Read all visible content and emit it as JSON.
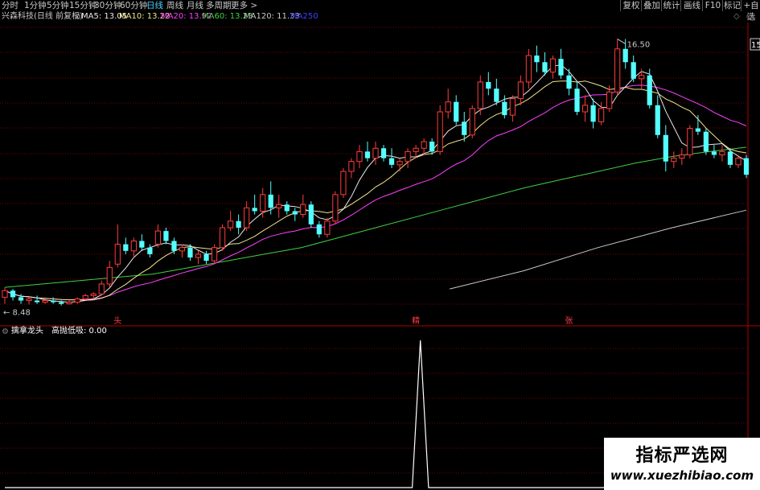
{
  "periods": [
    "分时",
    "1分钟",
    "5分钟",
    "15分钟",
    "30分钟",
    "60分钟",
    "日线",
    "周线",
    "月线",
    "多周期",
    "更多 >"
  ],
  "active_period": "日线",
  "toolbar": [
    "复权",
    "叠加",
    "统计",
    "画线",
    "F10",
    "标记",
    "+自选"
  ],
  "main": {
    "title": "兴森科技(日线 前复权)",
    "ma": [
      {
        "label": "MA5: 13.05",
        "color": "#e8e8e8"
      },
      {
        "label": "MA10: 13.22",
        "color": "#f0e68c"
      },
      {
        "label": "MA20: 13.92",
        "color": "#ff40ff"
      },
      {
        "label": "MA60: 13.23",
        "color": "#40d040"
      },
      {
        "label": "MA120: 11.33",
        "color": "#c8c8c8"
      },
      {
        "label": "MA250",
        "color": "#4040ff"
      }
    ],
    "high_label": "16.50",
    "low_label": "8.48",
    "right_label": "15",
    "signals": [
      {
        "text": "头",
        "idx": 14
      },
      {
        "text": "精",
        "idx": 51
      },
      {
        "text": "张",
        "idx": 70
      }
    ]
  },
  "sub": {
    "title": "擒拿龙头",
    "value_label": "高抛低吸: 0.00"
  },
  "watermark": {
    "cn": "指标严选网",
    "url": "www.xuezhibiao.com"
  },
  "colors": {
    "up": "#ff3c3c",
    "down": "#54ffff",
    "ma5": "#e8e8e8",
    "ma10": "#f0e68c",
    "ma20": "#ff40ff",
    "ma60": "#40d040",
    "ma120": "#c8c8c8",
    "grid": "#7a0000"
  },
  "chart_data": {
    "type": "candlestick",
    "candles": [
      [
        8.7,
        9.0,
        8.5,
        8.9
      ],
      [
        8.9,
        8.95,
        8.6,
        8.7
      ],
      [
        8.7,
        8.8,
        8.5,
        8.6
      ],
      [
        8.6,
        8.7,
        8.48,
        8.65
      ],
      [
        8.6,
        8.75,
        8.5,
        8.55
      ],
      [
        8.55,
        8.65,
        8.5,
        8.6
      ],
      [
        8.6,
        8.7,
        8.5,
        8.55
      ],
      [
        8.55,
        8.6,
        8.45,
        8.5
      ],
      [
        8.5,
        8.6,
        8.48,
        8.55
      ],
      [
        8.55,
        8.7,
        8.5,
        8.65
      ],
      [
        8.65,
        8.8,
        8.6,
        8.75
      ],
      [
        8.75,
        8.85,
        8.65,
        8.8
      ],
      [
        8.8,
        9.2,
        8.75,
        9.1
      ],
      [
        9.1,
        9.8,
        9.0,
        9.6
      ],
      [
        9.7,
        10.9,
        9.6,
        10.3
      ],
      [
        10.3,
        10.5,
        10.0,
        10.1
      ],
      [
        10.1,
        10.5,
        9.9,
        10.4
      ],
      [
        10.4,
        10.6,
        10.1,
        10.2
      ],
      [
        10.2,
        10.3,
        9.9,
        10.0
      ],
      [
        10.3,
        10.9,
        10.2,
        10.7
      ],
      [
        10.7,
        10.8,
        10.3,
        10.4
      ],
      [
        10.4,
        10.5,
        10.0,
        10.1
      ],
      [
        10.1,
        10.3,
        9.9,
        10.2
      ],
      [
        10.2,
        10.3,
        9.8,
        9.9
      ],
      [
        9.9,
        10.1,
        9.7,
        10.0
      ],
      [
        10.0,
        10.1,
        9.7,
        9.8
      ],
      [
        9.8,
        10.3,
        9.7,
        10.2
      ],
      [
        10.2,
        10.9,
        10.1,
        10.8
      ],
      [
        10.8,
        11.3,
        10.7,
        11.0
      ],
      [
        11.0,
        11.2,
        10.6,
        10.8
      ],
      [
        10.8,
        11.6,
        10.7,
        11.4
      ],
      [
        11.4,
        11.8,
        11.2,
        11.3
      ],
      [
        11.3,
        12.0,
        11.1,
        11.8
      ],
      [
        11.8,
        12.2,
        11.2,
        11.4
      ],
      [
        11.4,
        11.8,
        11.1,
        11.5
      ],
      [
        11.5,
        11.6,
        11.2,
        11.3
      ],
      [
        11.3,
        11.4,
        11.0,
        11.2
      ],
      [
        11.2,
        11.8,
        11.1,
        11.5
      ],
      [
        11.5,
        11.6,
        10.8,
        10.9
      ],
      [
        10.9,
        11.0,
        10.5,
        10.6
      ],
      [
        10.6,
        11.1,
        10.5,
        11.0
      ],
      [
        11.0,
        11.9,
        10.9,
        11.8
      ],
      [
        11.8,
        12.6,
        11.7,
        12.5
      ],
      [
        12.5,
        12.9,
        12.3,
        12.8
      ],
      [
        12.8,
        13.3,
        12.6,
        13.1
      ],
      [
        13.1,
        13.4,
        12.8,
        12.9
      ],
      [
        12.9,
        13.4,
        12.7,
        13.2
      ],
      [
        13.2,
        13.3,
        12.8,
        12.9
      ],
      [
        12.9,
        13.2,
        12.6,
        12.7
      ],
      [
        12.7,
        12.9,
        12.5,
        12.8
      ],
      [
        12.8,
        13.2,
        12.6,
        13.1
      ],
      [
        13.1,
        13.3,
        12.9,
        13.2
      ],
      [
        13.2,
        13.5,
        13.0,
        13.4
      ],
      [
        13.4,
        13.5,
        13.0,
        13.1
      ],
      [
        13.1,
        14.5,
        13.0,
        14.3
      ],
      [
        14.3,
        15.0,
        14.1,
        14.6
      ],
      [
        14.6,
        14.8,
        13.9,
        14.0
      ],
      [
        14.0,
        14.3,
        13.4,
        13.6
      ],
      [
        13.6,
        14.5,
        13.5,
        14.4
      ],
      [
        14.4,
        15.4,
        14.2,
        15.2
      ],
      [
        15.2,
        15.5,
        14.8,
        15.0
      ],
      [
        15.0,
        15.3,
        14.5,
        14.6
      ],
      [
        14.6,
        14.8,
        14.1,
        14.2
      ],
      [
        14.2,
        14.8,
        14.0,
        14.7
      ],
      [
        14.7,
        15.4,
        14.5,
        15.2
      ],
      [
        15.2,
        16.2,
        15.0,
        16.0
      ],
      [
        16.0,
        16.3,
        15.5,
        15.8
      ],
      [
        15.8,
        16.1,
        15.4,
        15.5
      ],
      [
        15.5,
        16.0,
        15.3,
        15.9
      ],
      [
        15.9,
        16.2,
        15.3,
        15.4
      ],
      [
        15.4,
        15.6,
        14.8,
        15.0
      ],
      [
        15.0,
        15.2,
        14.2,
        14.3
      ],
      [
        14.3,
        14.8,
        14.0,
        14.5
      ],
      [
        14.5,
        14.7,
        13.8,
        14.0
      ],
      [
        14.0,
        14.6,
        13.9,
        14.4
      ],
      [
        14.4,
        15.1,
        14.3,
        14.9
      ],
      [
        14.9,
        16.5,
        14.8,
        16.2
      ],
      [
        16.2,
        16.5,
        15.6,
        15.8
      ],
      [
        15.8,
        16.0,
        15.2,
        15.3
      ],
      [
        15.3,
        15.6,
        15.0,
        15.4
      ],
      [
        15.4,
        15.6,
        14.4,
        14.5
      ],
      [
        14.5,
        14.8,
        13.5,
        13.6
      ],
      [
        13.6,
        13.9,
        12.5,
        12.8
      ],
      [
        12.8,
        13.1,
        12.6,
        12.9
      ],
      [
        12.9,
        13.2,
        12.7,
        13.0
      ],
      [
        13.0,
        13.9,
        12.9,
        13.8
      ],
      [
        13.8,
        14.2,
        13.6,
        13.7
      ],
      [
        13.7,
        13.8,
        13.0,
        13.1
      ],
      [
        13.1,
        13.3,
        12.9,
        13.0
      ],
      [
        13.0,
        13.3,
        12.8,
        13.1
      ],
      [
        13.1,
        13.2,
        12.6,
        12.7
      ],
      [
        12.7,
        13.0,
        12.6,
        12.9
      ],
      [
        12.9,
        13.0,
        12.3,
        12.4
      ]
    ],
    "ma60": [
      9.0,
      9.1,
      9.2,
      9.3,
      9.4,
      9.6,
      9.8,
      10.0,
      10.2,
      10.5,
      10.8,
      11.1,
      11.4,
      11.7,
      12.0,
      12.25,
      12.5,
      12.75,
      12.95,
      13.1,
      13.23
    ],
    "ma120": [
      [
        0.6,
        8.95
      ],
      [
        0.7,
        9.5
      ],
      [
        0.8,
        10.2
      ],
      [
        0.9,
        10.8
      ],
      [
        1.0,
        11.33
      ]
    ],
    "sub_series": [
      0,
      0,
      0,
      0,
      0,
      0,
      0,
      0,
      0,
      0,
      0,
      0,
      0,
      0,
      0,
      0,
      0,
      0,
      0,
      0,
      0,
      0,
      0,
      0,
      0,
      0,
      0,
      0,
      0,
      0,
      0,
      0,
      0,
      0,
      0,
      0,
      0,
      0,
      0,
      0,
      0,
      0,
      0,
      0,
      0,
      0,
      0,
      0,
      0,
      0,
      0,
      100,
      0,
      0,
      0,
      0,
      0,
      0,
      0,
      0,
      0,
      0,
      0,
      0,
      0,
      0,
      0,
      0,
      0,
      0,
      0,
      0,
      0,
      0,
      0,
      0,
      0,
      0,
      0,
      0,
      0,
      0,
      0,
      0,
      0,
      0,
      0,
      0,
      0,
      0,
      0,
      0
    ]
  }
}
